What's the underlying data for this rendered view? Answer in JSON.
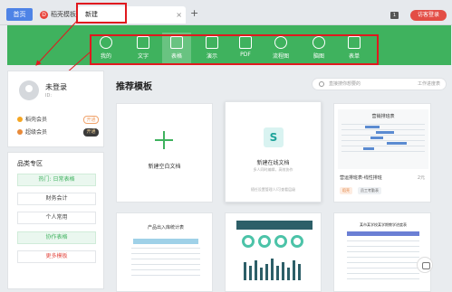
{
  "tabs": {
    "home": "首页",
    "templates": "稻壳模板",
    "templates_icon": "daoke-icon",
    "active": "新建",
    "close": "×",
    "plus": "+",
    "login": "访客登录"
  },
  "categories": [
    {
      "label": "我的",
      "icon": "star-icon"
    },
    {
      "label": "文字",
      "icon": "document-icon"
    },
    {
      "label": "表格",
      "icon": "table-icon",
      "selected": true
    },
    {
      "label": "演示",
      "icon": "presentation-icon"
    },
    {
      "label": "PDF",
      "icon": "pdf-icon"
    },
    {
      "label": "流程图",
      "icon": "flowchart-icon"
    },
    {
      "label": "脑图",
      "icon": "mindmap-icon"
    },
    {
      "label": "表单",
      "icon": "form-icon"
    }
  ],
  "profile": {
    "name": "未登录",
    "id": "ID:",
    "vip1": "稻壳会员",
    "vip1_btn": "开通",
    "vip2": "超级会员",
    "vip2_btn": "开通"
  },
  "zone": {
    "title": "品类专区",
    "items": [
      {
        "label": "热门: 日常表格",
        "active": true
      },
      {
        "label": "财务会计"
      },
      {
        "label": "个人常用"
      },
      {
        "label": "协作表格",
        "active": true
      },
      {
        "label": "更多模板",
        "red": true
      }
    ]
  },
  "main": {
    "title": "推荐模板",
    "search_placeholder": "直接搜你想要的",
    "search_category": "工作进度表"
  },
  "cards": {
    "blank": "新建空白文档",
    "online": "新建在线文档",
    "online_icon": "S",
    "online_sub1": "多人同时编辑，高效协作",
    "online_sub2": "随任设置管理人/可查看层级",
    "gantt_sheet_title": "营销排班表",
    "gantt_name": "营运排班表-线性排班",
    "gantt_price": "2元",
    "gantt_tag1": "稻壳",
    "gantt_tag2": "员工考勤表",
    "sheet2_title": "产品出入库统计表",
    "sheet4_title": "某市某学校某学期教学进度表"
  },
  "colors": {
    "accent": "#3fb25e",
    "highlight": "#e0191e",
    "home_tab": "#4e83e6",
    "login": "#e34d45"
  }
}
